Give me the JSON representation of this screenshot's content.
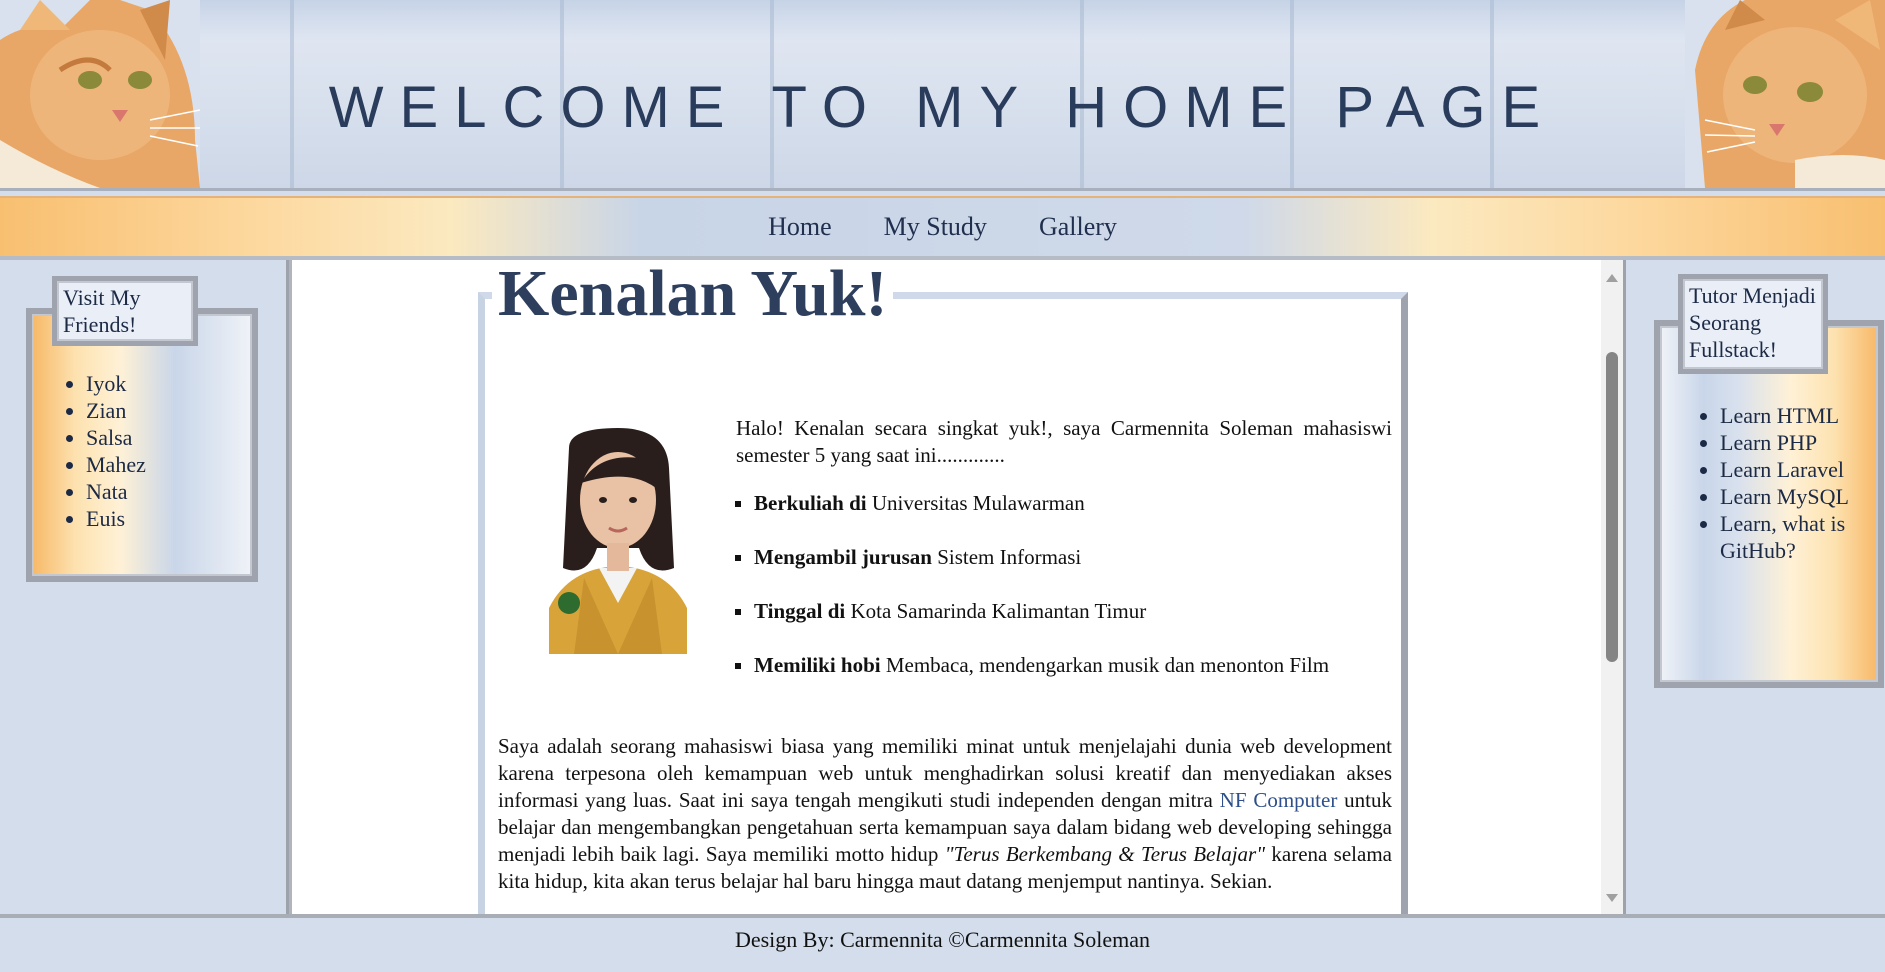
{
  "header": {
    "title": "WELCOME TO MY HOME PAGE"
  },
  "nav": {
    "items": [
      "Home",
      "My Study",
      "Gallery"
    ]
  },
  "left_sidebar": {
    "title": "Visit My Friends!",
    "friends": [
      "Iyok",
      "Zian",
      "Salsa",
      "Mahez",
      "Nata",
      "Euis"
    ]
  },
  "right_sidebar": {
    "title": "Tutor Menjadi Seorang Fullstack!",
    "links": [
      "Learn HTML",
      "Learn PHP",
      "Learn Laravel",
      "Learn MySQL",
      "Learn, what is GitHub?"
    ]
  },
  "main": {
    "title": "Kenalan Yuk!",
    "intro": "Halo! Kenalan secara singkat yuk!, saya Carmennita Soleman mahasiswi semester 5 yang saat ini.............",
    "facts": [
      {
        "label": "Berkuliah di",
        "value": "Universitas Mulawarman"
      },
      {
        "label": "Mengambil jurusan",
        "value": "Sistem Informasi"
      },
      {
        "label": "Tinggal di",
        "value": "Kota Samarinda Kalimantan Timur"
      },
      {
        "label": "Memiliki hobi",
        "value": "Membaca, mendengarkan musik dan menonton Film"
      }
    ],
    "paragraph": {
      "part1": "Saya adalah seorang mahasiswi biasa yang memiliki minat untuk menjelajahi dunia web development karena terpesona oleh kemampuan web untuk menghadirkan solusi kreatif dan menyediakan akses informasi yang luas. Saat ini saya tengah mengikuti studi independen dengan mitra",
      "link": "NF Computer",
      "part2": "untuk belajar dan mengembangkan pengetahuan serta kemampuan saya dalam bidang web developing sehingga menjadi lebih baik lagi. Saya memiliki motto hidup",
      "motto": "\"Terus Berkembang & Terus Belajar\"",
      "part3": "karena selama kita hidup, kita akan terus belajar hal baru hingga maut datang menjemput nantinya. Sekian."
    }
  },
  "footer": {
    "text": "Design By: Carmennita ©Carmennita Soleman"
  },
  "colors": {
    "accent_orange": "#f8bf70",
    "accent_blue": "#c9d6e9",
    "title_color": "#2e3f5e"
  }
}
